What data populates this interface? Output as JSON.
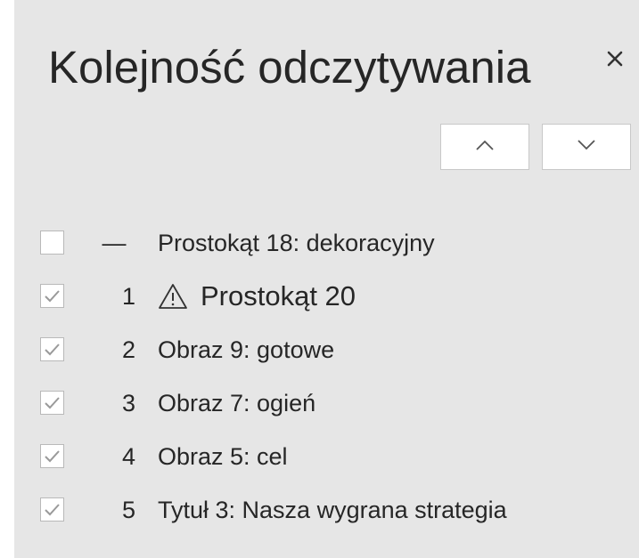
{
  "pane": {
    "title": "Kolejność odczytywania",
    "close_glyph": "×"
  },
  "toolbar": {
    "move_up_icon": "chevron-up-icon",
    "move_down_icon": "chevron-down-icon"
  },
  "items": [
    {
      "checked": false,
      "order": "—",
      "label": "Prostokąt 18: dekoracyjny",
      "warning": false
    },
    {
      "checked": true,
      "order": "1",
      "label": "Prostokąt 20",
      "warning": true
    },
    {
      "checked": true,
      "order": "2",
      "label": "Obraz 9: gotowe",
      "warning": false
    },
    {
      "checked": true,
      "order": "3",
      "label": "Obraz 7: ogień",
      "warning": false
    },
    {
      "checked": true,
      "order": "4",
      "label": "Obraz 5: cel",
      "warning": false
    },
    {
      "checked": true,
      "order": "5",
      "label": "Tytuł 3: Nasza wygrana strategia",
      "warning": false
    }
  ],
  "colors": {
    "pane_background": "#e6e6e6",
    "text": "#262626",
    "checkmark": "#9a9a9a",
    "button_background": "#ffffff"
  }
}
